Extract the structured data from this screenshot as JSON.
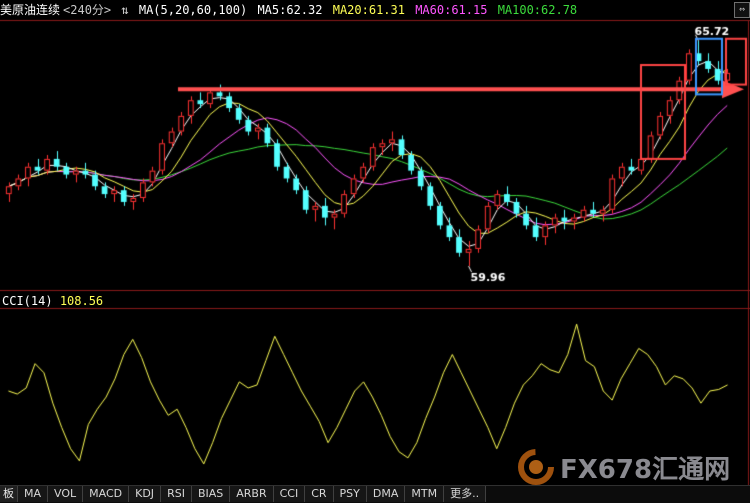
{
  "header": {
    "symbol": "美原油连续",
    "period": "<240分>",
    "toggle_glyph": "⇅",
    "ma_params": "MA(5,20,60,100)",
    "ma5": "MA5:62.32",
    "ma20": "MA20:61.31",
    "ma60": "MA60:61.15",
    "ma100": "MA100:62.78"
  },
  "cci_header": {
    "name": "CCI(14)",
    "value": "108.56"
  },
  "corner_button": "⇔",
  "annotations": {
    "high": "65.72",
    "low": "59.96"
  },
  "tabs": [
    "板",
    "MA",
    "VOL",
    "MACD",
    "KDJ",
    "RSI",
    "BIAS",
    "ARBR",
    "CCI",
    "CR",
    "PSY",
    "DMA",
    "MTM",
    "更多.."
  ],
  "watermark": {
    "text": "FX678汇通网"
  },
  "colors": {
    "background": "#000000",
    "up": "#ff3232",
    "down": "#54ffff",
    "ma5": "#ffffff",
    "ma20": "#ffff55",
    "ma60": "#ff55ff",
    "ma100": "#3cdc3c",
    "cci": "#ffff55",
    "annotation_box": "#ff4444",
    "annotation_box_blue": "#3c96ff",
    "arrow": "#ff5050"
  },
  "chart_data": [
    {
      "type": "candlestick",
      "title": "美原油连续<240分>",
      "ylim": [
        59.4,
        66.2
      ],
      "bars": [
        [
          61.8,
          62.1,
          61.6,
          62.0
        ],
        [
          62.0,
          62.3,
          61.9,
          62.2
        ],
        [
          62.2,
          62.6,
          62.0,
          62.5
        ],
        [
          62.5,
          62.7,
          62.3,
          62.4
        ],
        [
          62.4,
          62.8,
          62.3,
          62.7
        ],
        [
          62.7,
          62.9,
          62.4,
          62.5
        ],
        [
          62.5,
          62.6,
          62.2,
          62.3
        ],
        [
          62.3,
          62.5,
          62.1,
          62.4
        ],
        [
          62.4,
          62.6,
          62.2,
          62.3
        ],
        [
          62.3,
          62.4,
          61.9,
          62.0
        ],
        [
          62.0,
          62.1,
          61.7,
          61.8
        ],
        [
          61.8,
          62.0,
          61.6,
          61.9
        ],
        [
          61.9,
          62.0,
          61.5,
          61.6
        ],
        [
          61.6,
          61.8,
          61.4,
          61.7
        ],
        [
          61.7,
          62.2,
          61.6,
          62.1
        ],
        [
          62.1,
          62.5,
          62.0,
          62.4
        ],
        [
          62.4,
          63.2,
          62.3,
          63.1
        ],
        [
          63.1,
          63.5,
          63.0,
          63.4
        ],
        [
          63.4,
          63.9,
          63.3,
          63.8
        ],
        [
          63.8,
          64.3,
          63.6,
          64.2
        ],
        [
          64.2,
          64.4,
          64.0,
          64.1
        ],
        [
          64.1,
          64.5,
          64.0,
          64.4
        ],
        [
          64.4,
          64.6,
          64.2,
          64.3
        ],
        [
          64.3,
          64.4,
          63.9,
          64.0
        ],
        [
          64.0,
          64.1,
          63.6,
          63.7
        ],
        [
          63.7,
          63.8,
          63.3,
          63.4
        ],
        [
          63.4,
          63.6,
          63.2,
          63.5
        ],
        [
          63.5,
          63.6,
          63.0,
          63.1
        ],
        [
          63.1,
          63.2,
          62.4,
          62.5
        ],
        [
          62.5,
          62.6,
          62.1,
          62.2
        ],
        [
          62.2,
          62.3,
          61.8,
          61.9
        ],
        [
          61.9,
          62.0,
          61.3,
          61.4
        ],
        [
          61.4,
          61.6,
          61.1,
          61.5
        ],
        [
          61.5,
          61.7,
          61.0,
          61.2
        ],
        [
          61.2,
          61.4,
          60.9,
          61.3
        ],
        [
          61.3,
          61.9,
          61.2,
          61.8
        ],
        [
          61.8,
          62.3,
          61.7,
          62.2
        ],
        [
          62.2,
          62.6,
          62.1,
          62.5
        ],
        [
          62.5,
          63.1,
          62.4,
          63.0
        ],
        [
          63.0,
          63.2,
          62.8,
          63.1
        ],
        [
          63.1,
          63.4,
          62.9,
          63.2
        ],
        [
          63.2,
          63.3,
          62.7,
          62.8
        ],
        [
          62.8,
          62.9,
          62.3,
          62.4
        ],
        [
          62.4,
          62.5,
          61.9,
          62.0
        ],
        [
          62.0,
          62.1,
          61.4,
          61.5
        ],
        [
          61.5,
          61.6,
          60.9,
          61.0
        ],
        [
          61.0,
          61.2,
          60.6,
          60.7
        ],
        [
          60.7,
          60.9,
          60.2,
          60.3
        ],
        [
          60.3,
          60.6,
          59.96,
          60.4
        ],
        [
          60.4,
          61.0,
          60.3,
          60.9
        ],
        [
          60.9,
          61.6,
          60.8,
          61.5
        ],
        [
          61.5,
          61.9,
          61.4,
          61.8
        ],
        [
          61.8,
          62.0,
          61.5,
          61.6
        ],
        [
          61.6,
          61.7,
          61.2,
          61.3
        ],
        [
          61.3,
          61.5,
          60.9,
          61.0
        ],
        [
          61.0,
          61.2,
          60.6,
          60.7
        ],
        [
          60.7,
          61.1,
          60.5,
          61.0
        ],
        [
          61.0,
          61.3,
          60.8,
          61.2
        ],
        [
          61.2,
          61.4,
          60.9,
          61.1
        ],
        [
          61.1,
          61.3,
          60.9,
          61.2
        ],
        [
          61.2,
          61.5,
          61.1,
          61.4
        ],
        [
          61.4,
          61.6,
          61.2,
          61.3
        ],
        [
          61.3,
          61.5,
          61.1,
          61.4
        ],
        [
          61.4,
          62.3,
          61.3,
          62.2
        ],
        [
          62.2,
          62.6,
          62.0,
          62.5
        ],
        [
          62.5,
          62.7,
          62.3,
          62.4
        ],
        [
          62.4,
          62.8,
          62.3,
          62.7
        ],
        [
          62.7,
          63.4,
          62.6,
          63.3
        ],
        [
          63.3,
          63.9,
          63.2,
          63.8
        ],
        [
          63.8,
          64.3,
          63.6,
          64.2
        ],
        [
          64.2,
          64.8,
          64.1,
          64.7
        ],
        [
          64.7,
          65.5,
          64.6,
          65.4
        ],
        [
          65.4,
          65.72,
          65.1,
          65.2
        ],
        [
          65.2,
          65.4,
          64.9,
          65.0
        ],
        [
          65.0,
          65.2,
          64.6,
          64.7
        ],
        [
          64.7,
          65.0,
          64.5,
          64.9
        ]
      ]
    },
    {
      "type": "line",
      "title": "CCI(14)",
      "ylim": [
        -260,
        260
      ],
      "values": [
        0,
        -10,
        10,
        90,
        60,
        -40,
        -120,
        -190,
        -230,
        -110,
        -60,
        -20,
        40,
        120,
        170,
        110,
        30,
        -30,
        -80,
        -60,
        -120,
        -190,
        -240,
        -170,
        -90,
        -30,
        30,
        10,
        20,
        100,
        180,
        120,
        60,
        0,
        -50,
        -100,
        -170,
        -120,
        -60,
        0,
        30,
        -20,
        -80,
        -150,
        -200,
        -220,
        -170,
        -90,
        -20,
        60,
        120,
        60,
        0,
        -60,
        -120,
        -190,
        -120,
        -40,
        20,
        50,
        90,
        70,
        60,
        120,
        220,
        100,
        80,
        0,
        -30,
        40,
        90,
        140,
        120,
        80,
        20,
        50,
        40,
        10,
        -40,
        0,
        5,
        20
      ]
    }
  ]
}
